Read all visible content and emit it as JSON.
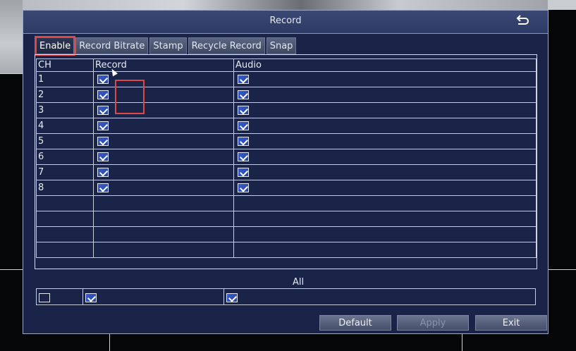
{
  "window": {
    "title": "Record"
  },
  "tabs": [
    {
      "label": "Enable",
      "active": true
    },
    {
      "label": "Record Bitrate",
      "active": false
    },
    {
      "label": "Stamp",
      "active": false
    },
    {
      "label": "Recycle Record",
      "active": false
    },
    {
      "label": "Snap",
      "active": false
    }
  ],
  "table": {
    "headers": {
      "ch": "CH",
      "record": "Record",
      "audio": "Audio"
    },
    "rows": [
      {
        "ch": "1",
        "record": true,
        "audio": true
      },
      {
        "ch": "2",
        "record": true,
        "audio": true
      },
      {
        "ch": "3",
        "record": true,
        "audio": true
      },
      {
        "ch": "4",
        "record": true,
        "audio": true
      },
      {
        "ch": "5",
        "record": true,
        "audio": true
      },
      {
        "ch": "6",
        "record": true,
        "audio": true
      },
      {
        "ch": "7",
        "record": true,
        "audio": true
      },
      {
        "ch": "8",
        "record": true,
        "audio": true
      }
    ],
    "empty_rows": 4
  },
  "all": {
    "label": "All",
    "select_all": false,
    "record": true,
    "audio": true
  },
  "buttons": {
    "default": "Default",
    "apply": "Apply",
    "exit": "Exit"
  },
  "icons": {
    "back": "return-arrow-icon",
    "checkbox": "checkmark-icon",
    "cursor": "mouse-pointer-icon"
  },
  "colors": {
    "highlight": "#e04848",
    "checkbox": "#2f50b8",
    "panel": "#1a2448"
  }
}
